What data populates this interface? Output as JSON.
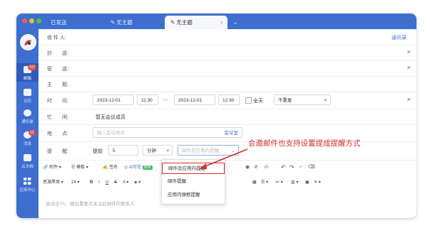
{
  "window": {
    "traffic_colors": [
      "#fc5b57",
      "#e5bf3c",
      "#57c038"
    ],
    "tabs": [
      {
        "label": "已发送"
      },
      {
        "label": "无主题"
      },
      {
        "label": "无主题"
      }
    ],
    "tab_close": "×",
    "tab_more": "⌄"
  },
  "sidebar": {
    "items": [
      {
        "label": "邮箱",
        "badge": "107"
      },
      {
        "label": "日历"
      },
      {
        "label": "通讯录"
      },
      {
        "label": "消息",
        "badge": "12"
      },
      {
        "label": "云文档"
      },
      {
        "label": "应用中心"
      }
    ]
  },
  "compose": {
    "to_label": "收 件 人:",
    "address_book": "通讯录",
    "cc_label": "抄　　送:",
    "bcc_label": "密　　送:",
    "subject_label": "主　　题:",
    "time_label": "时　　间:",
    "start_date": "2023-12-01",
    "start_time": "11:30",
    "dash": "—",
    "end_date": "2023-12-01",
    "end_time": "12:30",
    "all_day": "全天",
    "repeat": "不重复",
    "busy_label": "忙　　闲:",
    "busy_value": "暂无会议成员",
    "location_label": "地　　点:",
    "location_placeholder": "输入会议地点",
    "meeting_room": "会议室",
    "reminder_label": "提　　醒:",
    "reminder_prefix": "提前",
    "reminder_value": "5",
    "reminder_unit": "分钟",
    "reminder_method": "邮件及应用内提醒",
    "close": "×"
  },
  "toolbar1": {
    "attach": "附件",
    "template": "模板",
    "signature": "签名",
    "ai": "AI写信",
    "ai_tag": "限免"
  },
  "toolbar2": {
    "font": "思源黑体",
    "size": "24"
  },
  "editor": {
    "placeholder": "尝试@TA，圈出重要点关注此邮件的联系人"
  },
  "dropdown": {
    "options": [
      "邮件及应用内提醒",
      "邮件提醒",
      "应用内弹框提醒"
    ]
  },
  "annotation": {
    "text": "会邀邮件也支持设置提成提醒方式",
    "color": "#d32f2f"
  }
}
